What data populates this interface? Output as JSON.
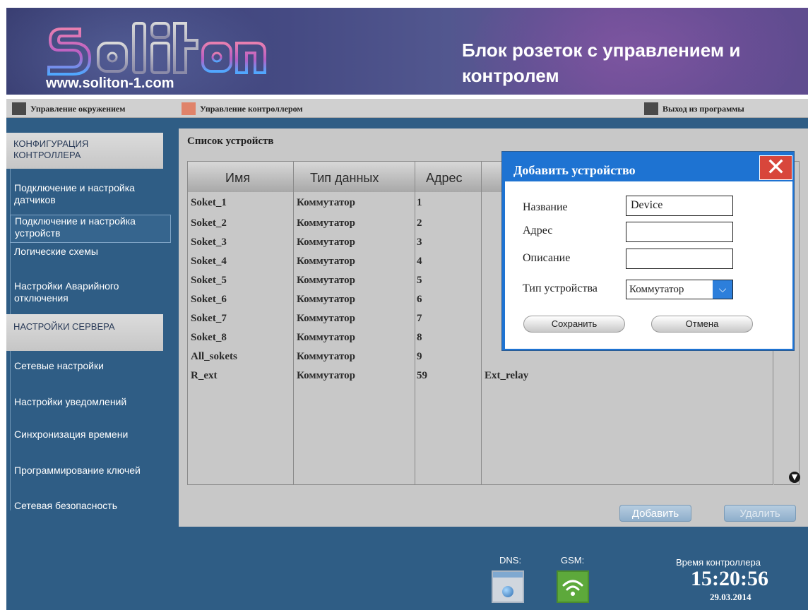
{
  "header": {
    "logo_text": "Soliton",
    "site_url": "www.soliton-1.com",
    "title": "Блок розеток с управлением и контролем"
  },
  "topnav": {
    "env": "Управление окружением",
    "controller": "Управление контроллером",
    "exit": "Выход из программы"
  },
  "sidebar": {
    "section_config": "КОНФИГУРАЦИЯ КОНТРОЛЛЕРА",
    "items_config": [
      "Подключение и настройка датчиков",
      "Подключение и настройка устройств",
      "Логические схемы",
      "Настройки Аварийного отключения"
    ],
    "section_server": "НАСТРОЙКИ СЕРВЕРА",
    "items_server": [
      "Сетевые настройки",
      "Настройки уведомлений",
      "Синхронизация времени",
      "Программирование ключей",
      "Сетевая безопасность"
    ]
  },
  "content": {
    "title": "Список устройств",
    "columns": [
      "Имя",
      "Тип данных",
      "Адрес"
    ],
    "rows": [
      {
        "name": "Soket_1",
        "type": "Коммутатор",
        "address": "1",
        "desc": ""
      },
      {
        "name": "Soket_2",
        "type": "Коммутатор",
        "address": "2",
        "desc": ""
      },
      {
        "name": "Soket_3",
        "type": "Коммутатор",
        "address": "3",
        "desc": ""
      },
      {
        "name": "Soket_4",
        "type": "Коммутатор",
        "address": "4",
        "desc": ""
      },
      {
        "name": "Soket_5",
        "type": "Коммутатор",
        "address": "5",
        "desc": ""
      },
      {
        "name": "Soket_6",
        "type": "Коммутатор",
        "address": "6",
        "desc": ""
      },
      {
        "name": "Soket_7",
        "type": "Коммутатор",
        "address": "7",
        "desc": ""
      },
      {
        "name": "Soket_8",
        "type": "Коммутатор",
        "address": "8",
        "desc": ""
      },
      {
        "name": "All_sokets",
        "type": "Коммутатор",
        "address": "9",
        "desc": ""
      },
      {
        "name": "R_ext",
        "type": "Коммутатор",
        "address": "59",
        "desc": "Ext_relay"
      }
    ],
    "add_button": "Добавить",
    "delete_button": "Удалить"
  },
  "dialog": {
    "title": "Добавить устройство",
    "label_name": "Название",
    "value_name": "Device",
    "label_address": "Адрес",
    "value_address": "",
    "label_description": "Описание",
    "value_description": "",
    "label_type": "Тип устройства",
    "value_type": "Коммутатор",
    "save_button": "Сохранить",
    "cancel_button": "Отмена"
  },
  "footer": {
    "dns_label": "DNS:",
    "gsm_label": "GSM:",
    "time_label": "Время контроллера",
    "time": "15:20:56",
    "date": "29.03.2014"
  },
  "colors": {
    "main_background": "#2f5d85",
    "header_background": "#454a83",
    "dialog_accent": "#1e73d2",
    "close_button": "#d8463b",
    "nav_marker_env": "#4a4a4a",
    "nav_marker_ctrl": "#e0836a",
    "nav_marker_exit": "#4a4a4a"
  },
  "icons": {
    "close": "close-icon",
    "dropdown": "chevron-down-icon",
    "scroll": "arrow-down-circle-icon",
    "dns": "globe-window-icon",
    "gsm": "wifi-signal-icon"
  }
}
